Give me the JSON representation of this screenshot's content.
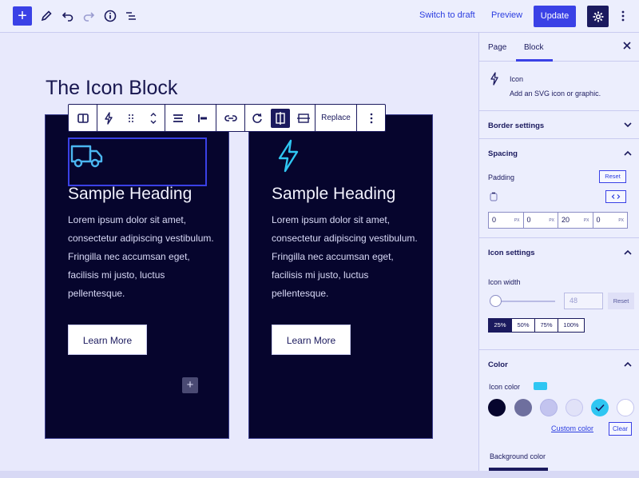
{
  "topbar": {
    "switch_to_draft": "Switch to draft",
    "preview": "Preview",
    "update": "Update",
    "icons": [
      "plus-icon",
      "pencil-icon",
      "undo-icon",
      "redo-icon",
      "info-icon",
      "list-view-icon",
      "gear-icon",
      "more-vertical-icon"
    ]
  },
  "canvas": {
    "page_title": "The Icon Block",
    "cards": [
      {
        "icon": "truck-icon",
        "heading": "Sample Heading",
        "text": "Lorem ipsum dolor sit amet, consectetur adipiscing vestibulum. Fringilla nec accumsan eget, facilisis mi justo, luctus pellentesque.",
        "button": "Learn More"
      },
      {
        "icon": "bolt-icon",
        "heading": "Sample Heading",
        "text": "Lorem ipsum dolor sit amet, consectetur adipiscing vestibulum. Fringilla nec accumsan eget, facilisis mi justo, luctus pellentesque.",
        "button": "Learn More"
      }
    ],
    "add_block": "+"
  },
  "block_toolbar": {
    "replace": "Replace"
  },
  "sidebar": {
    "tabs": [
      "Page",
      "Block"
    ],
    "active_tab": "Block",
    "block_name": "Icon",
    "block_desc": "Add an SVG icon or graphic.",
    "border_settings": "Border settings",
    "spacing": {
      "title": "Spacing",
      "padding_label": "Padding",
      "reset": "Reset",
      "values": [
        "0",
        "0",
        "20",
        "0"
      ],
      "unit": "PX"
    },
    "icon_settings": {
      "title": "Icon settings",
      "width_label": "Icon width",
      "width_placeholder": "48",
      "reset": "Reset",
      "percent_options": [
        "25%",
        "50%",
        "75%",
        "100%"
      ],
      "selected": "25%"
    },
    "color": {
      "title": "Color",
      "icon_color_label": "Icon color",
      "icon_color_value": "#2fc6f2",
      "swatches": [
        "#06052d",
        "#6e6f9e",
        "#c3c4ef",
        "#e1e2f8",
        "#2fc6f2",
        "#ffffff"
      ],
      "selected_swatch": "#2fc6f2",
      "custom_color": "Custom color",
      "clear": "Clear",
      "background_color_label": "Background color"
    }
  },
  "colors": {
    "accent": "#3a41e6",
    "dark": "#1b1a5e",
    "card_bg": "#06052d",
    "icon_blue": "#2fc6f2"
  }
}
